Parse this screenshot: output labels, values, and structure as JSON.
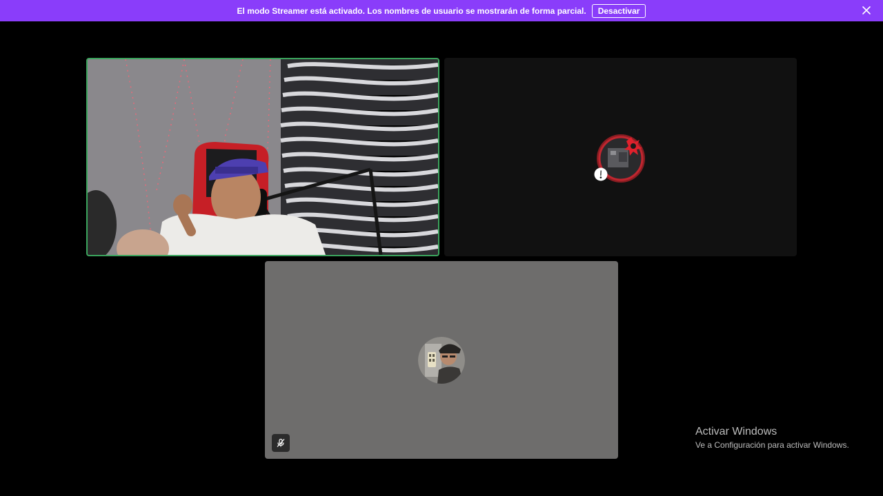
{
  "banner": {
    "message": "El modo Streamer está activado. Los nombres de usuario se mostrarán de forma parcial.",
    "button_label": "Desactivar",
    "close_icon": "close-icon",
    "background_color": "#8a3dfa"
  },
  "tiles": [
    {
      "type": "video",
      "speaking": true,
      "speaking_color": "#3ba55d"
    },
    {
      "type": "avatar",
      "status_icon": "warning-icon"
    },
    {
      "type": "avatar",
      "muted": true,
      "mute_icon": "microphone-muted-icon"
    }
  ],
  "watermark": {
    "title": "Activar Windows",
    "subtitle": "Ve a Configuración para activar Windows."
  }
}
